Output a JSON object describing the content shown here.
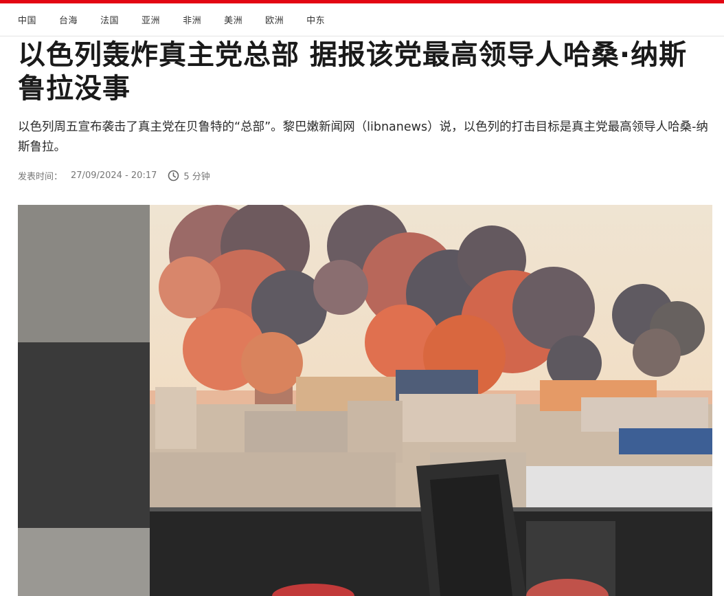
{
  "nav": {
    "items": [
      "中国",
      "台海",
      "法国",
      "亚洲",
      "非洲",
      "美洲",
      "欧洲",
      "中东"
    ]
  },
  "article": {
    "headline": "以色列轰炸真主党总部 据报该党最高领导人哈桑·纳斯鲁拉没事",
    "summary": "以色列周五宣布袭击了真主党在贝鲁特的“总部”。黎巴嫩新闻网（libnanews）说，以色列的打击目标是真主党最高领导人哈桑-纳斯鲁拉。",
    "published_label": "发表时间：",
    "published_time": "27/09/2024 - 20:17",
    "read_time": "5 分钟",
    "read_time_icon": "clock-icon"
  },
  "colors": {
    "accent": "#e30613"
  }
}
